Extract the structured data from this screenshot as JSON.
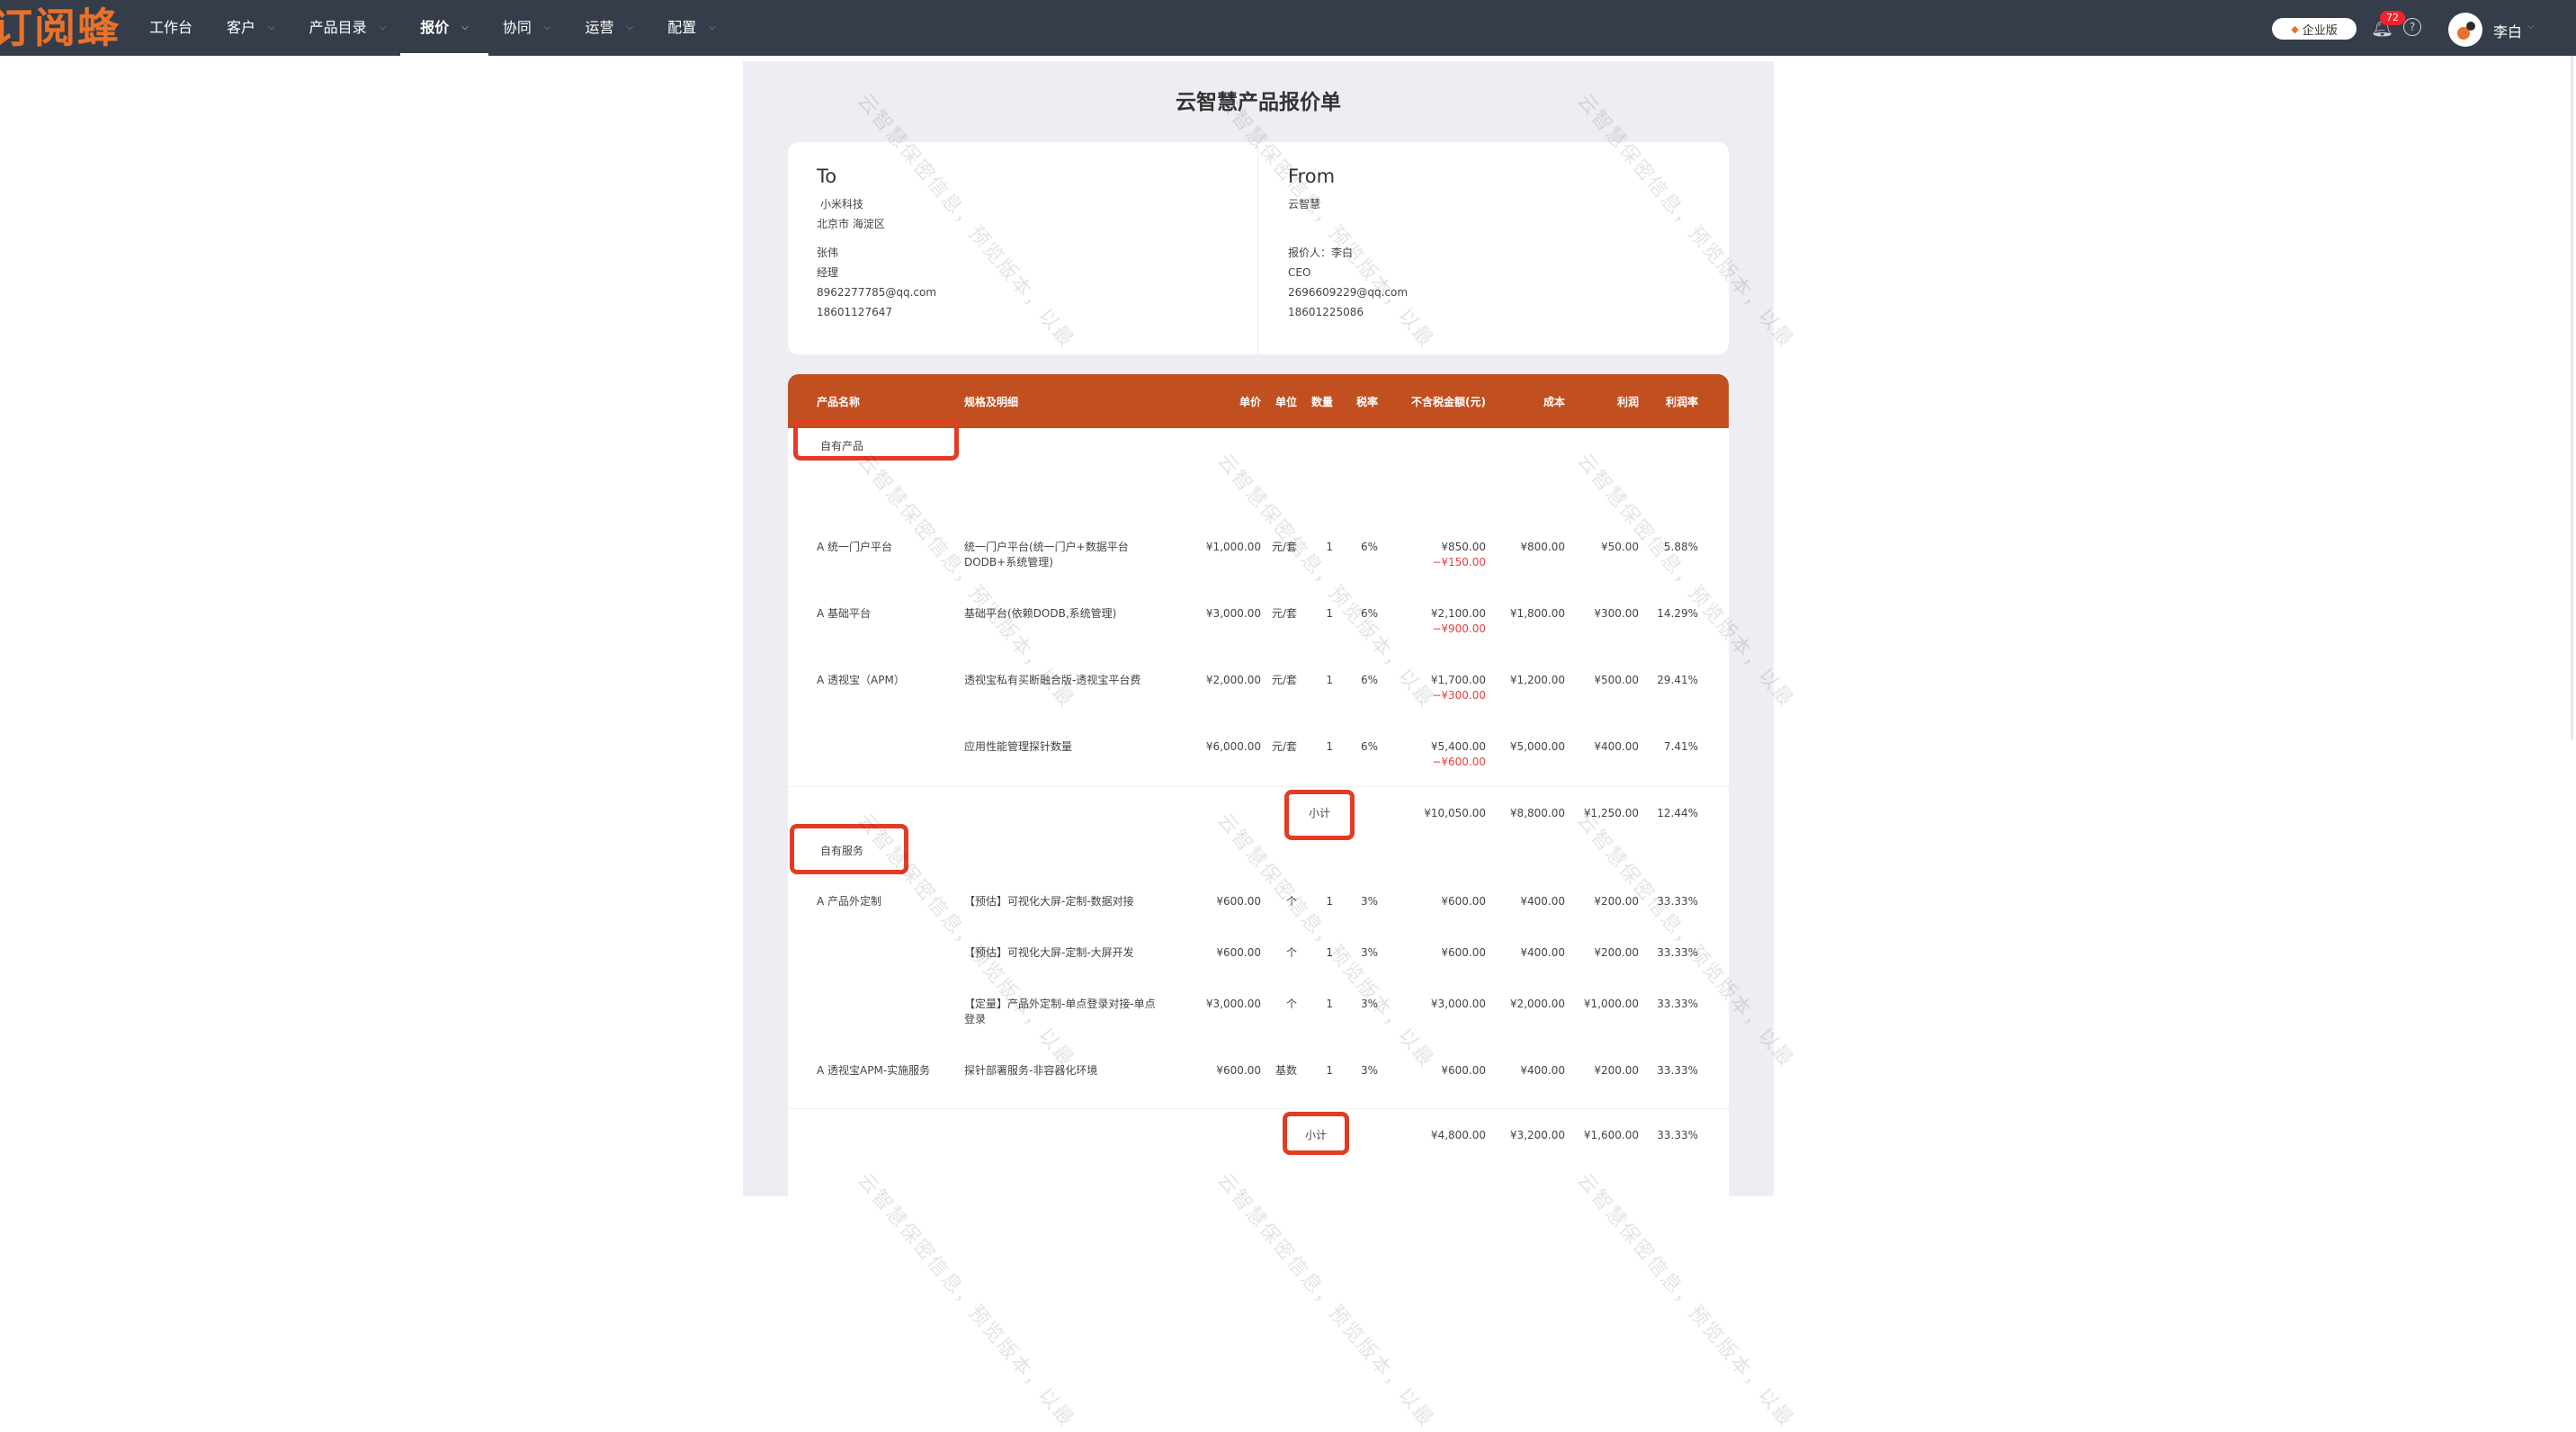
{
  "nav": {
    "logo": "订阅蜂",
    "menu": [
      {
        "label": "工作台",
        "has_caret": false,
        "active": false
      },
      {
        "label": "客户",
        "has_caret": true,
        "active": false
      },
      {
        "label": "产品目录",
        "has_caret": true,
        "active": false
      },
      {
        "label": "报价",
        "has_caret": true,
        "active": true
      },
      {
        "label": "协同",
        "has_caret": true,
        "active": false
      },
      {
        "label": "运营",
        "has_caret": true,
        "active": false
      },
      {
        "label": "配置",
        "has_caret": true,
        "active": false
      }
    ],
    "enterprise_label": "企业版",
    "notification_count": "72",
    "help_glyph": "?",
    "user_name": "李白"
  },
  "document": {
    "title": "云智慧产品报价单",
    "watermark_text": "云智慧保密信息，预览版本，以最"
  },
  "to": {
    "heading": "To",
    "company": "小米科技",
    "address": "北京市 海淀区",
    "contact": "张伟",
    "position": "经理",
    "email": "8962277785@qq.com",
    "phone": "18601127647"
  },
  "from": {
    "heading": "From",
    "company": "云智慧",
    "quoter": "报价人：李白",
    "position": "CEO",
    "email": "2696609229@qq.com",
    "phone": "18601225086"
  },
  "table": {
    "headers": {
      "name": "产品名称",
      "spec": "规格及明细",
      "price": "单价",
      "unit": "单位",
      "qty": "数量",
      "tax": "税率",
      "amount": "不含税金额(元)",
      "cost": "成本",
      "profit": "利润",
      "margin": "利润率"
    },
    "groups": [
      {
        "title": "自有产品",
        "rows": [
          {
            "name": "A 统一门户平台",
            "spec": "统一门户平台(统一门户+数据平台DODB+系统管理)",
            "price": "¥1,000.00",
            "unit": "元/套",
            "qty": "1",
            "tax": "6%",
            "amount": "¥850.00",
            "discount": "−¥150.00",
            "cost": "¥800.00",
            "profit": "¥50.00",
            "margin": "5.88%"
          },
          {
            "name": "A 基础平台",
            "spec": "基础平台(依赖DODB,系统管理)",
            "price": "¥3,000.00",
            "unit": "元/套",
            "qty": "1",
            "tax": "6%",
            "amount": "¥2,100.00",
            "discount": "−¥900.00",
            "cost": "¥1,800.00",
            "profit": "¥300.00",
            "margin": "14.29%"
          },
          {
            "name": "A 透视宝（APM）",
            "spec": "透视宝私有买断融合版-透视宝平台费",
            "price": "¥2,000.00",
            "unit": "元/套",
            "qty": "1",
            "tax": "6%",
            "amount": "¥1,700.00",
            "discount": "−¥300.00",
            "cost": "¥1,200.00",
            "profit": "¥500.00",
            "margin": "29.41%"
          },
          {
            "name": "",
            "spec": "应用性能管理探针数量",
            "price": "¥6,000.00",
            "unit": "元/套",
            "qty": "1",
            "tax": "6%",
            "amount": "¥5,400.00",
            "discount": "−¥600.00",
            "cost": "¥5,000.00",
            "profit": "¥400.00",
            "margin": "7.41%"
          }
        ],
        "subtotal": {
          "label": "小计",
          "amount": "¥10,050.00",
          "cost": "¥8,800.00",
          "profit": "¥1,250.00",
          "margin": "12.44%"
        }
      },
      {
        "title": "自有服务",
        "rows": [
          {
            "name": "A 产品外定制",
            "spec": "【预估】可视化大屏-定制-数据对接",
            "price": "¥600.00",
            "unit": "个",
            "qty": "1",
            "tax": "3%",
            "amount": "¥600.00",
            "discount": "",
            "cost": "¥400.00",
            "profit": "¥200.00",
            "margin": "33.33%"
          },
          {
            "name": "",
            "spec": "【预估】可视化大屏-定制-大屏开发",
            "price": "¥600.00",
            "unit": "个",
            "qty": "1",
            "tax": "3%",
            "amount": "¥600.00",
            "discount": "",
            "cost": "¥400.00",
            "profit": "¥200.00",
            "margin": "33.33%"
          },
          {
            "name": "",
            "spec": "【定量】产品外定制-单点登录对接-单点登录",
            "price": "¥3,000.00",
            "unit": "个",
            "qty": "1",
            "tax": "3%",
            "amount": "¥3,000.00",
            "discount": "",
            "cost": "¥2,000.00",
            "profit": "¥1,000.00",
            "margin": "33.33%"
          },
          {
            "name": "A 透视宝APM-实施服务",
            "spec": "探针部署服务-非容器化环境",
            "price": "¥600.00",
            "unit": "基数",
            "qty": "1",
            "tax": "3%",
            "amount": "¥600.00",
            "discount": "",
            "cost": "¥400.00",
            "profit": "¥200.00",
            "margin": "33.33%"
          }
        ],
        "subtotal": {
          "label": "小计",
          "amount": "¥4,800.00",
          "cost": "¥3,200.00",
          "profit": "¥1,600.00",
          "margin": "33.33%"
        }
      }
    ]
  },
  "colors": {
    "nav_bg": "#353d4a",
    "brand_orange": "#e8712b",
    "table_header": "#c14f1f",
    "highlight_box": "#e43b24",
    "discount_red": "#e53e3e",
    "page_bg": "#eceef4"
  },
  "icons": [
    "bell-icon",
    "help-icon",
    "diamond-icon",
    "chevron-down-icon",
    "avatar"
  ]
}
